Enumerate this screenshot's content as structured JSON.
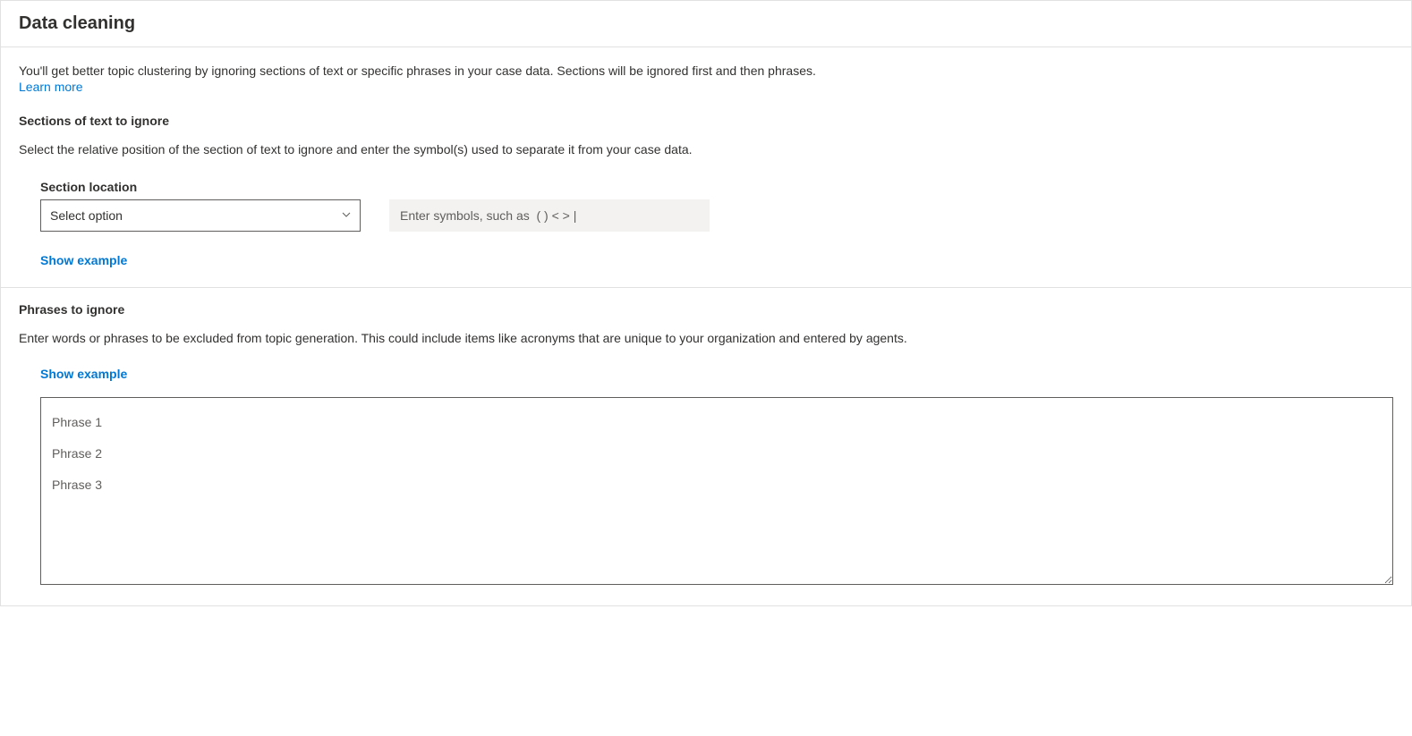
{
  "header": {
    "title": "Data cleaning"
  },
  "intro": {
    "text": "You'll get better topic clustering by ignoring sections of text or specific phrases in your case data. Sections will be ignored first and then phrases.",
    "learn_more": "Learn more"
  },
  "sections_ignore": {
    "heading": "Sections of text to ignore",
    "description": "Select the relative position of the section of text to ignore and enter the symbol(s) used to separate it from your case data.",
    "location_label": "Section location",
    "select_placeholder": "Select option",
    "symbols_placeholder": "Enter symbols, such as  ( ) < > |",
    "show_example": "Show example"
  },
  "phrases_ignore": {
    "heading": "Phrases to ignore",
    "description": "Enter words or phrases to be excluded from topic generation. This could include items like acronyms that are unique to your organization and entered by agents.",
    "show_example": "Show example",
    "textarea_placeholder": "Phrase 1\nPhrase 2\nPhrase 3"
  }
}
